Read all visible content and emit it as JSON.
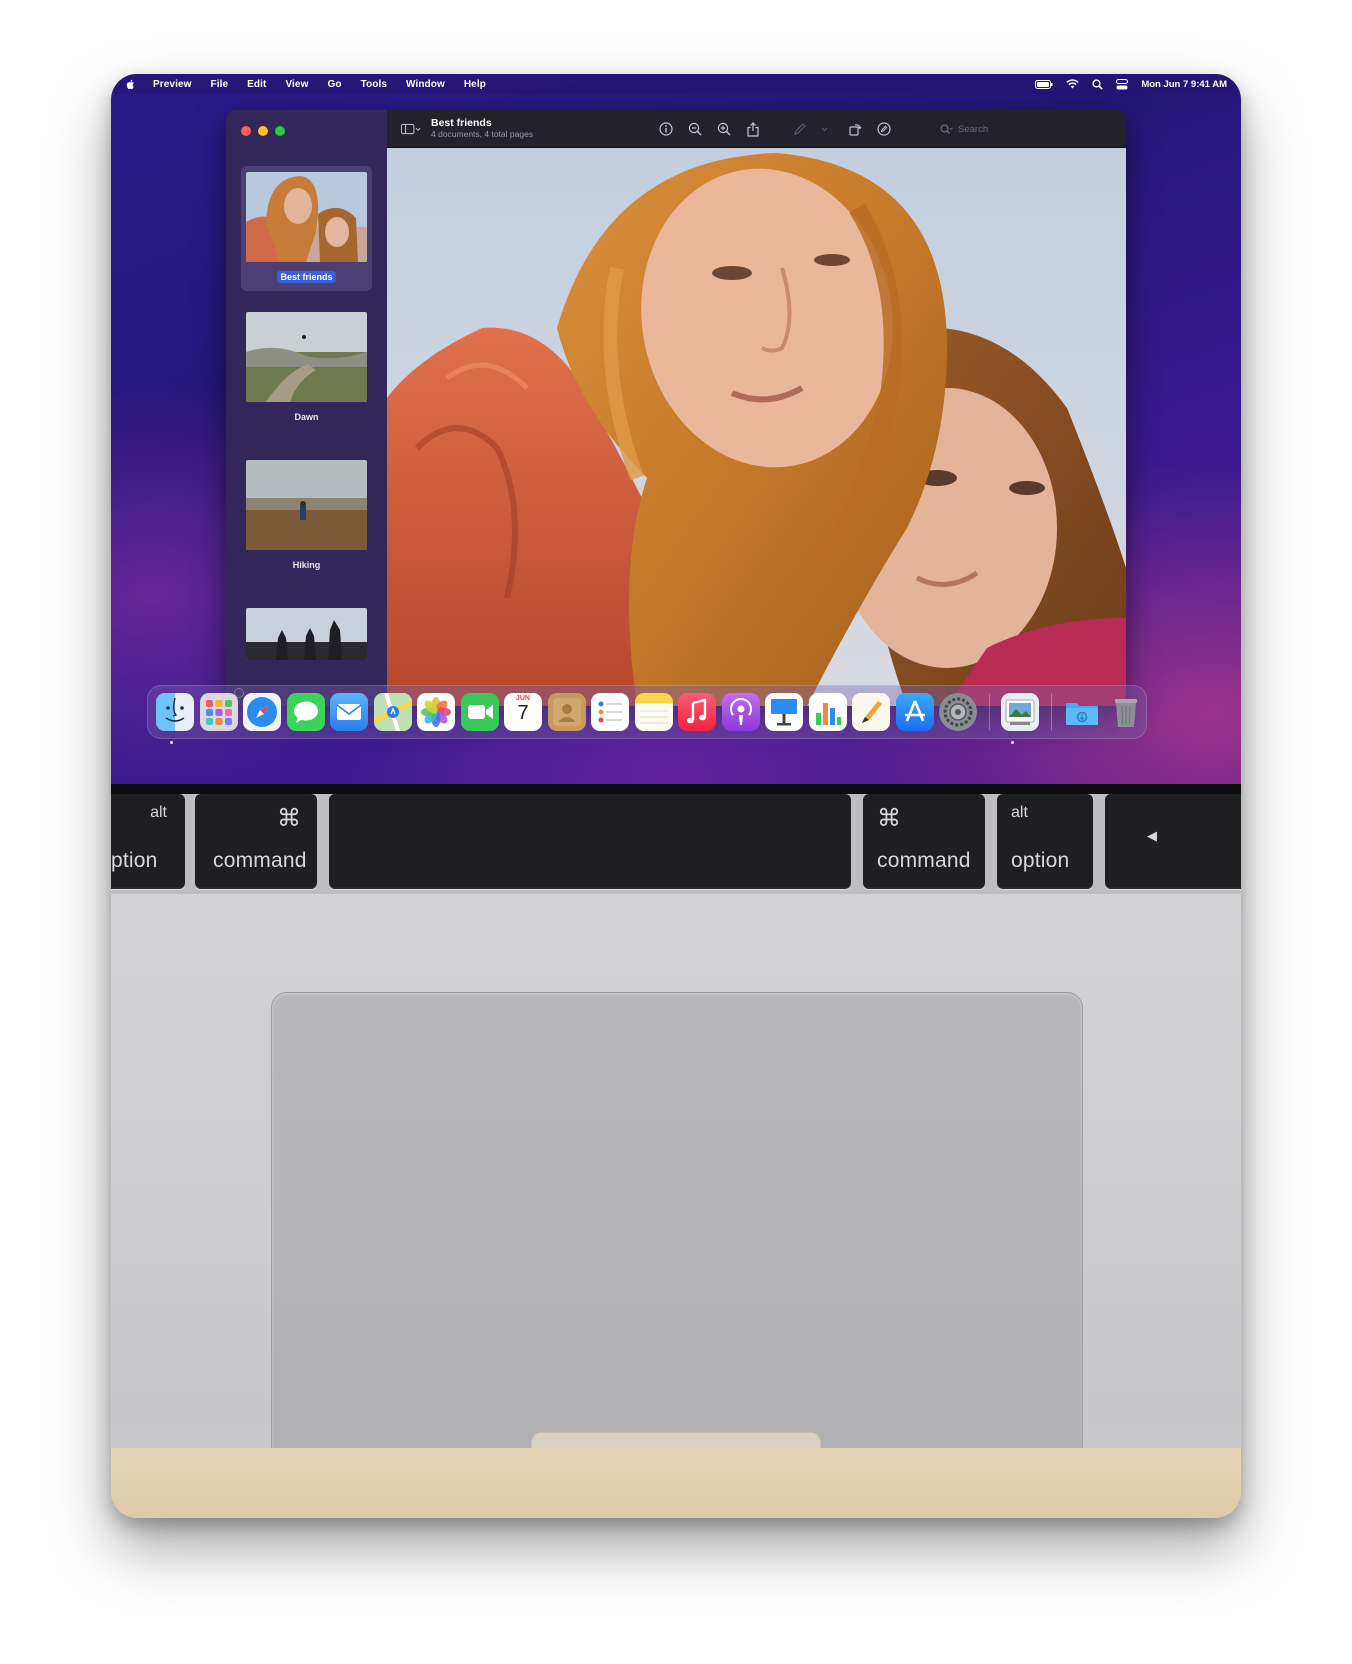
{
  "menubar": {
    "app": "Preview",
    "menus": [
      "File",
      "Edit",
      "View",
      "Go",
      "Tools",
      "Window",
      "Help"
    ],
    "clock": "Mon Jun 7  9:41 AM"
  },
  "window": {
    "title": "Best friends",
    "subtitle": "4 documents, 4 total pages",
    "search_placeholder": "Search"
  },
  "sidebar": {
    "items": [
      {
        "label": "Best friends",
        "selected": true
      },
      {
        "label": "Dawn"
      },
      {
        "label": "Hiking"
      },
      {
        "label": ""
      }
    ]
  },
  "dock": {
    "apps": [
      "Finder",
      "Launchpad",
      "Safari",
      "Messages",
      "Mail",
      "Maps",
      "Photos",
      "FaceTime",
      "Calendar",
      "Contacts",
      "Reminders",
      "Notes",
      "Music",
      "Podcasts",
      "Keynote",
      "Numbers",
      "Pages",
      "App Store",
      "System Preferences",
      "Preview",
      "Downloads",
      "Trash"
    ],
    "calendar_month": "JUN",
    "calendar_day": "7"
  },
  "keyboard": {
    "left_option_small": "alt",
    "left_option": "ption",
    "left_command_symbol": "⌘",
    "left_command": "command",
    "right_command_symbol": "⌘",
    "right_command": "command",
    "right_option_small": "alt",
    "right_option": "option",
    "arrow_left": "◀"
  },
  "colors": {
    "wallpaper": "#2a1a8a",
    "selection": "#3a5fd6",
    "key": "#1f1f22",
    "aluminum": "#c9c9cc"
  }
}
